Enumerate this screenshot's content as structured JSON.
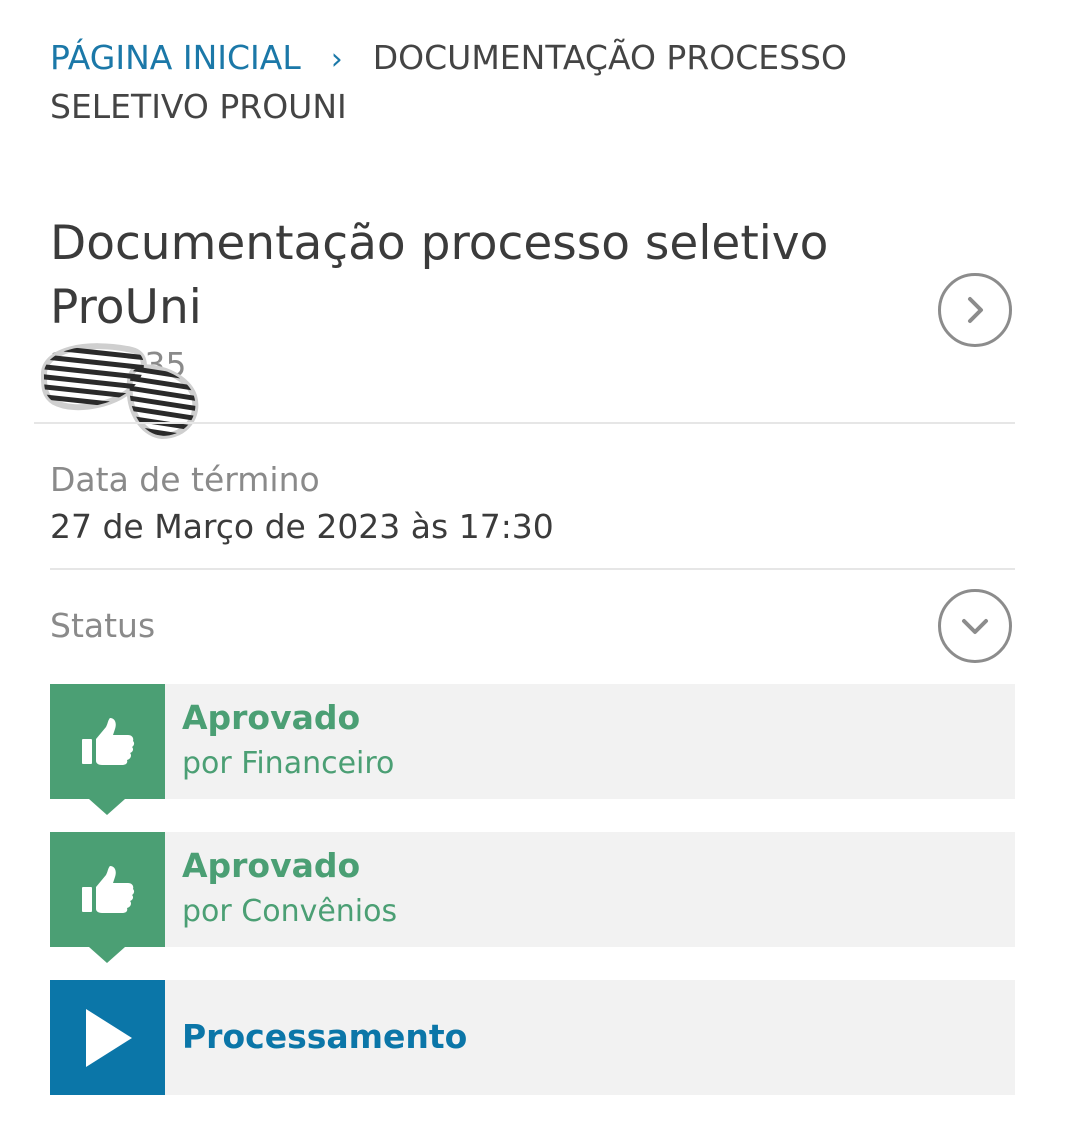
{
  "breadcrumb": {
    "home": "PÁGINA INICIAL",
    "separator": "›",
    "current": "DOCUMENTAÇÃO PROCESSO SELETIVO PROUNI"
  },
  "request": {
    "title": "Documentação processo seletivo ProUni",
    "id_partial": "2 14235"
  },
  "end_date": {
    "label": "Data de término",
    "value": "27 de Março de 2023 às 17:30"
  },
  "status": {
    "label": "Status",
    "steps": [
      {
        "title": "Aprovado",
        "subtitle": "por Financeiro",
        "icon": "thumbs-up-icon",
        "color": "#4b9f74"
      },
      {
        "title": "Aprovado",
        "subtitle": "por Convênios",
        "icon": "thumbs-up-icon",
        "color": "#4b9f74"
      },
      {
        "title": "Processamento",
        "subtitle": "",
        "icon": "play-icon",
        "color": "#0b76a8"
      }
    ]
  },
  "colors": {
    "link": "#1b78a8",
    "approved": "#4b9f74",
    "processing": "#0b76a8"
  }
}
